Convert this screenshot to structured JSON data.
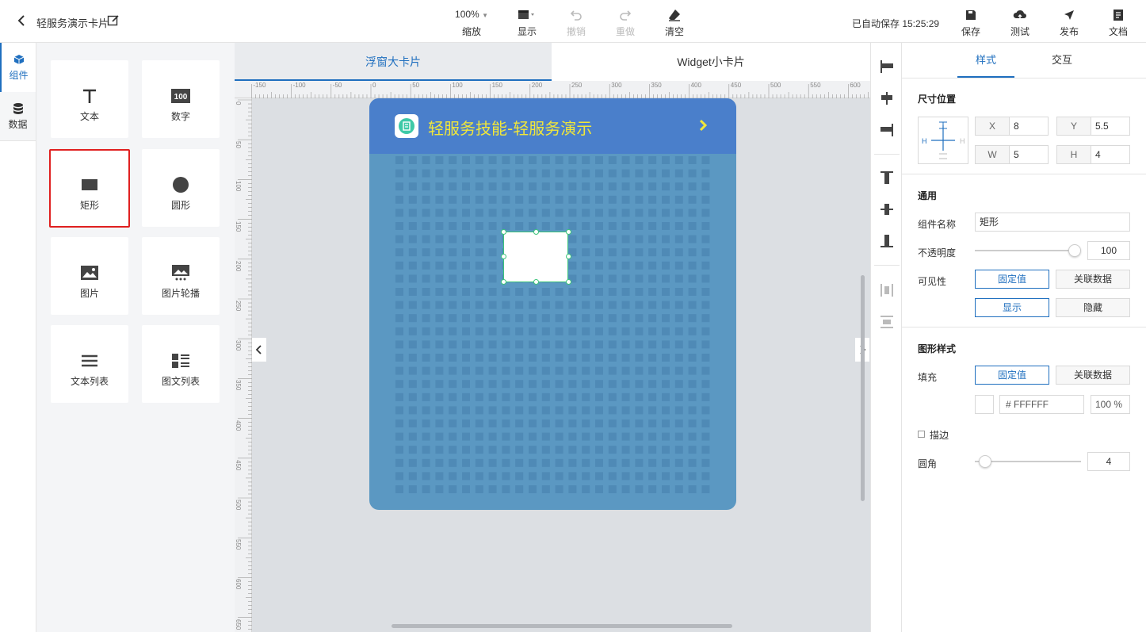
{
  "topbar": {
    "title": "轻服务演示卡片",
    "zoom_value": "100%",
    "zoom_label": "缩放",
    "display_label": "显示",
    "undo_label": "撤销",
    "redo_label": "重做",
    "clear_label": "清空",
    "autosave": "已自动保存 15:25:29",
    "save_label": "保存",
    "test_label": "测试",
    "publish_label": "发布",
    "docs_label": "文档"
  },
  "lefttabs": {
    "components": "组件",
    "data": "数据"
  },
  "components": [
    {
      "label": "文本",
      "icon": "text-icon"
    },
    {
      "label": "数字",
      "icon": "number-icon"
    },
    {
      "label": "矩形",
      "icon": "rectangle-icon"
    },
    {
      "label": "圆形",
      "icon": "circle-icon"
    },
    {
      "label": "图片",
      "icon": "image-icon"
    },
    {
      "label": "图片轮播",
      "icon": "carousel-icon"
    },
    {
      "label": "文本列表",
      "icon": "list-icon"
    },
    {
      "label": "图文列表",
      "icon": "image-list-icon"
    }
  ],
  "canvas": {
    "tab_float": "浮窗大卡片",
    "tab_widget": "Widget小卡片",
    "card_title": "轻服务技能-轻服务演示",
    "ruler_top": [
      "-150",
      "-100",
      "-50",
      "0",
      "50",
      "100",
      "150",
      "200",
      "250",
      "300",
      "350",
      "400",
      "450",
      "500",
      "550",
      "600"
    ],
    "ruler_left": [
      "0",
      "50",
      "100",
      "150",
      "200",
      "250",
      "300",
      "350",
      "400",
      "450",
      "500",
      "550",
      "600",
      "650"
    ]
  },
  "props": {
    "tab_style": "样式",
    "tab_interact": "交互",
    "size_title": "尺寸位置",
    "x_label": "X",
    "x_value": "8",
    "y_label": "Y",
    "y_value": "5.5",
    "w_label": "W",
    "w_value": "5",
    "h_label": "H",
    "h_value": "4",
    "general_title": "通用",
    "name_label": "组件名称",
    "name_value": "矩形",
    "opacity_label": "不透明度",
    "opacity_value": "100",
    "visibility_label": "可见性",
    "fixed_label": "固定值",
    "bind_label": "关联数据",
    "show_label": "显示",
    "hide_label": "隐藏",
    "shape_title": "图形样式",
    "fill_label": "填充",
    "fill_fixed": "固定值",
    "fill_bind": "关联数据",
    "fill_hex": "# FFFFFF",
    "fill_alpha": "100 %",
    "stroke_label": "描边",
    "radius_label": "圆角",
    "radius_value": "4"
  },
  "colors": {
    "accent": "#1f6fbf",
    "card_bg": "#5b98c2",
    "card_header": "#4a7fcb",
    "card_title": "#f1e73a",
    "selected_outline": "#e02020"
  }
}
